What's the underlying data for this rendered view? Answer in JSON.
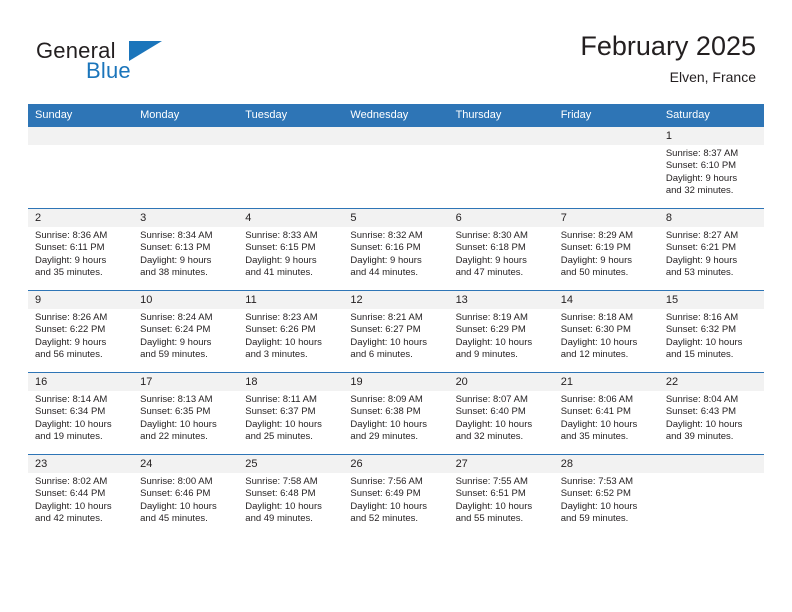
{
  "logo": {
    "word_general": "General",
    "word_blue": "Blue",
    "triangle_color": "#1b75bb",
    "general_color": "#231f20"
  },
  "header": {
    "title": "February 2025",
    "subtitle": "Elven, France"
  },
  "theme": {
    "header_blue": "#2e75b6",
    "daynum_band": "#f2f2f2",
    "text": "#231f20"
  },
  "weekday_headers": [
    "Sunday",
    "Monday",
    "Tuesday",
    "Wednesday",
    "Thursday",
    "Friday",
    "Saturday"
  ],
  "weeks": [
    [
      {
        "day": "",
        "sunrise": "",
        "sunset": "",
        "daylight_line1": "",
        "daylight_line2": ""
      },
      {
        "day": "",
        "sunrise": "",
        "sunset": "",
        "daylight_line1": "",
        "daylight_line2": ""
      },
      {
        "day": "",
        "sunrise": "",
        "sunset": "",
        "daylight_line1": "",
        "daylight_line2": ""
      },
      {
        "day": "",
        "sunrise": "",
        "sunset": "",
        "daylight_line1": "",
        "daylight_line2": ""
      },
      {
        "day": "",
        "sunrise": "",
        "sunset": "",
        "daylight_line1": "",
        "daylight_line2": ""
      },
      {
        "day": "",
        "sunrise": "",
        "sunset": "",
        "daylight_line1": "",
        "daylight_line2": ""
      },
      {
        "day": "1",
        "sunrise": "Sunrise: 8:37 AM",
        "sunset": "Sunset: 6:10 PM",
        "daylight_line1": "Daylight: 9 hours",
        "daylight_line2": "and 32 minutes."
      }
    ],
    [
      {
        "day": "2",
        "sunrise": "Sunrise: 8:36 AM",
        "sunset": "Sunset: 6:11 PM",
        "daylight_line1": "Daylight: 9 hours",
        "daylight_line2": "and 35 minutes."
      },
      {
        "day": "3",
        "sunrise": "Sunrise: 8:34 AM",
        "sunset": "Sunset: 6:13 PM",
        "daylight_line1": "Daylight: 9 hours",
        "daylight_line2": "and 38 minutes."
      },
      {
        "day": "4",
        "sunrise": "Sunrise: 8:33 AM",
        "sunset": "Sunset: 6:15 PM",
        "daylight_line1": "Daylight: 9 hours",
        "daylight_line2": "and 41 minutes."
      },
      {
        "day": "5",
        "sunrise": "Sunrise: 8:32 AM",
        "sunset": "Sunset: 6:16 PM",
        "daylight_line1": "Daylight: 9 hours",
        "daylight_line2": "and 44 minutes."
      },
      {
        "day": "6",
        "sunrise": "Sunrise: 8:30 AM",
        "sunset": "Sunset: 6:18 PM",
        "daylight_line1": "Daylight: 9 hours",
        "daylight_line2": "and 47 minutes."
      },
      {
        "day": "7",
        "sunrise": "Sunrise: 8:29 AM",
        "sunset": "Sunset: 6:19 PM",
        "daylight_line1": "Daylight: 9 hours",
        "daylight_line2": "and 50 minutes."
      },
      {
        "day": "8",
        "sunrise": "Sunrise: 8:27 AM",
        "sunset": "Sunset: 6:21 PM",
        "daylight_line1": "Daylight: 9 hours",
        "daylight_line2": "and 53 minutes."
      }
    ],
    [
      {
        "day": "9",
        "sunrise": "Sunrise: 8:26 AM",
        "sunset": "Sunset: 6:22 PM",
        "daylight_line1": "Daylight: 9 hours",
        "daylight_line2": "and 56 minutes."
      },
      {
        "day": "10",
        "sunrise": "Sunrise: 8:24 AM",
        "sunset": "Sunset: 6:24 PM",
        "daylight_line1": "Daylight: 9 hours",
        "daylight_line2": "and 59 minutes."
      },
      {
        "day": "11",
        "sunrise": "Sunrise: 8:23 AM",
        "sunset": "Sunset: 6:26 PM",
        "daylight_line1": "Daylight: 10 hours",
        "daylight_line2": "and 3 minutes."
      },
      {
        "day": "12",
        "sunrise": "Sunrise: 8:21 AM",
        "sunset": "Sunset: 6:27 PM",
        "daylight_line1": "Daylight: 10 hours",
        "daylight_line2": "and 6 minutes."
      },
      {
        "day": "13",
        "sunrise": "Sunrise: 8:19 AM",
        "sunset": "Sunset: 6:29 PM",
        "daylight_line1": "Daylight: 10 hours",
        "daylight_line2": "and 9 minutes."
      },
      {
        "day": "14",
        "sunrise": "Sunrise: 8:18 AM",
        "sunset": "Sunset: 6:30 PM",
        "daylight_line1": "Daylight: 10 hours",
        "daylight_line2": "and 12 minutes."
      },
      {
        "day": "15",
        "sunrise": "Sunrise: 8:16 AM",
        "sunset": "Sunset: 6:32 PM",
        "daylight_line1": "Daylight: 10 hours",
        "daylight_line2": "and 15 minutes."
      }
    ],
    [
      {
        "day": "16",
        "sunrise": "Sunrise: 8:14 AM",
        "sunset": "Sunset: 6:34 PM",
        "daylight_line1": "Daylight: 10 hours",
        "daylight_line2": "and 19 minutes."
      },
      {
        "day": "17",
        "sunrise": "Sunrise: 8:13 AM",
        "sunset": "Sunset: 6:35 PM",
        "daylight_line1": "Daylight: 10 hours",
        "daylight_line2": "and 22 minutes."
      },
      {
        "day": "18",
        "sunrise": "Sunrise: 8:11 AM",
        "sunset": "Sunset: 6:37 PM",
        "daylight_line1": "Daylight: 10 hours",
        "daylight_line2": "and 25 minutes."
      },
      {
        "day": "19",
        "sunrise": "Sunrise: 8:09 AM",
        "sunset": "Sunset: 6:38 PM",
        "daylight_line1": "Daylight: 10 hours",
        "daylight_line2": "and 29 minutes."
      },
      {
        "day": "20",
        "sunrise": "Sunrise: 8:07 AM",
        "sunset": "Sunset: 6:40 PM",
        "daylight_line1": "Daylight: 10 hours",
        "daylight_line2": "and 32 minutes."
      },
      {
        "day": "21",
        "sunrise": "Sunrise: 8:06 AM",
        "sunset": "Sunset: 6:41 PM",
        "daylight_line1": "Daylight: 10 hours",
        "daylight_line2": "and 35 minutes."
      },
      {
        "day": "22",
        "sunrise": "Sunrise: 8:04 AM",
        "sunset": "Sunset: 6:43 PM",
        "daylight_line1": "Daylight: 10 hours",
        "daylight_line2": "and 39 minutes."
      }
    ],
    [
      {
        "day": "23",
        "sunrise": "Sunrise: 8:02 AM",
        "sunset": "Sunset: 6:44 PM",
        "daylight_line1": "Daylight: 10 hours",
        "daylight_line2": "and 42 minutes."
      },
      {
        "day": "24",
        "sunrise": "Sunrise: 8:00 AM",
        "sunset": "Sunset: 6:46 PM",
        "daylight_line1": "Daylight: 10 hours",
        "daylight_line2": "and 45 minutes."
      },
      {
        "day": "25",
        "sunrise": "Sunrise: 7:58 AM",
        "sunset": "Sunset: 6:48 PM",
        "daylight_line1": "Daylight: 10 hours",
        "daylight_line2": "and 49 minutes."
      },
      {
        "day": "26",
        "sunrise": "Sunrise: 7:56 AM",
        "sunset": "Sunset: 6:49 PM",
        "daylight_line1": "Daylight: 10 hours",
        "daylight_line2": "and 52 minutes."
      },
      {
        "day": "27",
        "sunrise": "Sunrise: 7:55 AM",
        "sunset": "Sunset: 6:51 PM",
        "daylight_line1": "Daylight: 10 hours",
        "daylight_line2": "and 55 minutes."
      },
      {
        "day": "28",
        "sunrise": "Sunrise: 7:53 AM",
        "sunset": "Sunset: 6:52 PM",
        "daylight_line1": "Daylight: 10 hours",
        "daylight_line2": "and 59 minutes."
      },
      {
        "day": "",
        "sunrise": "",
        "sunset": "",
        "daylight_line1": "",
        "daylight_line2": ""
      }
    ]
  ]
}
